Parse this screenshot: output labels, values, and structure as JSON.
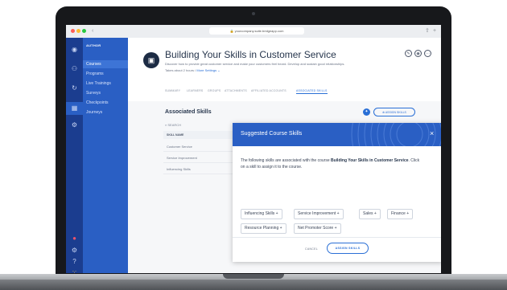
{
  "browser": {
    "url": "yourcompany.suite.bridgeapp.com",
    "back_icon": "chevron-left-icon",
    "colors": {
      "close": "#ff5f57",
      "minimize": "#febc2e",
      "maximize": "#28c840"
    }
  },
  "rail": {
    "items": [
      {
        "icon": "user-circle-icon",
        "label": "Me"
      },
      {
        "icon": "people-icon",
        "label": "My Team"
      },
      {
        "icon": "refresh-icon",
        "label": "Check-Ins"
      },
      {
        "icon": "grid-icon",
        "label": "Author"
      },
      {
        "icon": "gear-icon",
        "label": "Admin"
      }
    ]
  },
  "sidebar": {
    "header": "AUTHOR",
    "items": [
      {
        "label": "Courses",
        "active": true
      },
      {
        "label": "Programs",
        "active": false
      },
      {
        "label": "Live Trainings",
        "active": false
      },
      {
        "label": "Surveys",
        "active": false
      },
      {
        "label": "Checkpoints",
        "active": false
      },
      {
        "label": "Journeys",
        "active": false
      }
    ]
  },
  "course": {
    "title": "Building Your Skills in Customer Service",
    "description": "Discover how to provide great customer service and make your customers feel heard. Develop and sustain good relationships.",
    "meta": "Takes about 2 hours",
    "settings_link": "More Settings"
  },
  "tabs": [
    {
      "label": "SUMMARY",
      "active": false
    },
    {
      "label": "LEARNERS",
      "active": false
    },
    {
      "label": "GROUPS",
      "active": false
    },
    {
      "label": "ATTACHMENTS",
      "active": false
    },
    {
      "label": "AFFILIATED ACCOUNTS",
      "active": false
    },
    {
      "label": "ASSOCIATED SKILLS",
      "active": true
    }
  ],
  "skills_panel": {
    "title": "Associated Skills",
    "assign_button": "ASSIGN SKILLS",
    "search_placeholder": "SEARCH",
    "column_header": "SKILL NAME",
    "rows": [
      "Customer Service",
      "Service Improvement",
      "Influencing Skills"
    ]
  },
  "modal": {
    "title": "Suggested Course Skills",
    "intro": "The following skills are associated with the course",
    "course_name": "Building Your Skills in Customer Service",
    "instruction": "Click on a skill to assign it to the course.",
    "skills": [
      "Influencing Skills",
      "Service Improvement",
      "Sales",
      "Finance",
      "Resource Planning",
      "Net Promoter Score"
    ],
    "cancel_label": "CANCEL",
    "assign_label": "ASSIGN SKILLS"
  }
}
